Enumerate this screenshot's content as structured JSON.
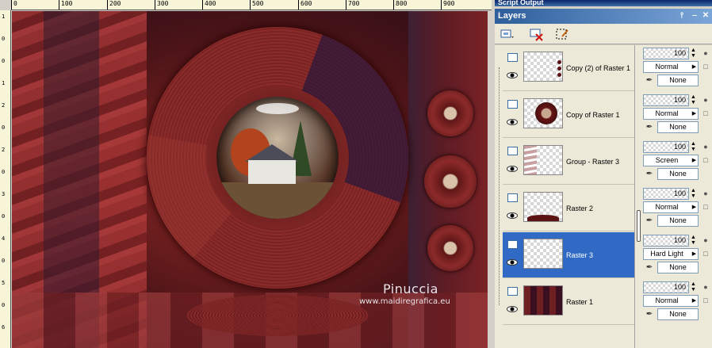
{
  "ruler": {
    "h_ticks": [
      "0",
      "100",
      "200",
      "300",
      "400",
      "500",
      "600",
      "700",
      "800",
      "900"
    ],
    "v_ticks": [
      "1",
      "0",
      "0",
      "1",
      "2",
      "0",
      "2",
      "0",
      "3",
      "0",
      "4",
      "0",
      "5",
      "0",
      "6"
    ]
  },
  "canvas": {
    "watermark_name": "Pinuccia",
    "watermark_url": "www.maidiregrafica.eu"
  },
  "script_output": {
    "title": "Script Output"
  },
  "layers_panel": {
    "title": "Layers",
    "pin_icon": "pin-icon",
    "minimize_icon": "minimize-icon",
    "close_icon": "close-icon",
    "toolbar": {
      "new_layer_icon": "new-layer-icon",
      "delete_layer_icon": "delete-layer-icon",
      "edit_selection_icon": "edit-selection-icon"
    },
    "layers": [
      {
        "name": "Copy (2) of Raster 1",
        "opacity": "100",
        "blend": "Normal",
        "mask": "None",
        "selected": false
      },
      {
        "name": "Copy of Raster 1",
        "opacity": "100",
        "blend": "Normal",
        "mask": "None",
        "selected": false
      },
      {
        "name": "Group - Raster 3",
        "opacity": "100",
        "blend": "Screen",
        "mask": "None",
        "selected": false
      },
      {
        "name": "Raster 2",
        "opacity": "100",
        "blend": "Normal",
        "mask": "None",
        "selected": false
      },
      {
        "name": "Raster 3",
        "opacity": "100",
        "blend": "Hard Light",
        "mask": "None",
        "selected": true
      },
      {
        "name": "Raster 1",
        "opacity": "100",
        "blend": "Normal",
        "mask": "None",
        "selected": false
      }
    ]
  },
  "colors": {
    "selection": "#316ac5",
    "titlebar": "#2e5e9b",
    "canvas_red": "#8e2a2a"
  }
}
